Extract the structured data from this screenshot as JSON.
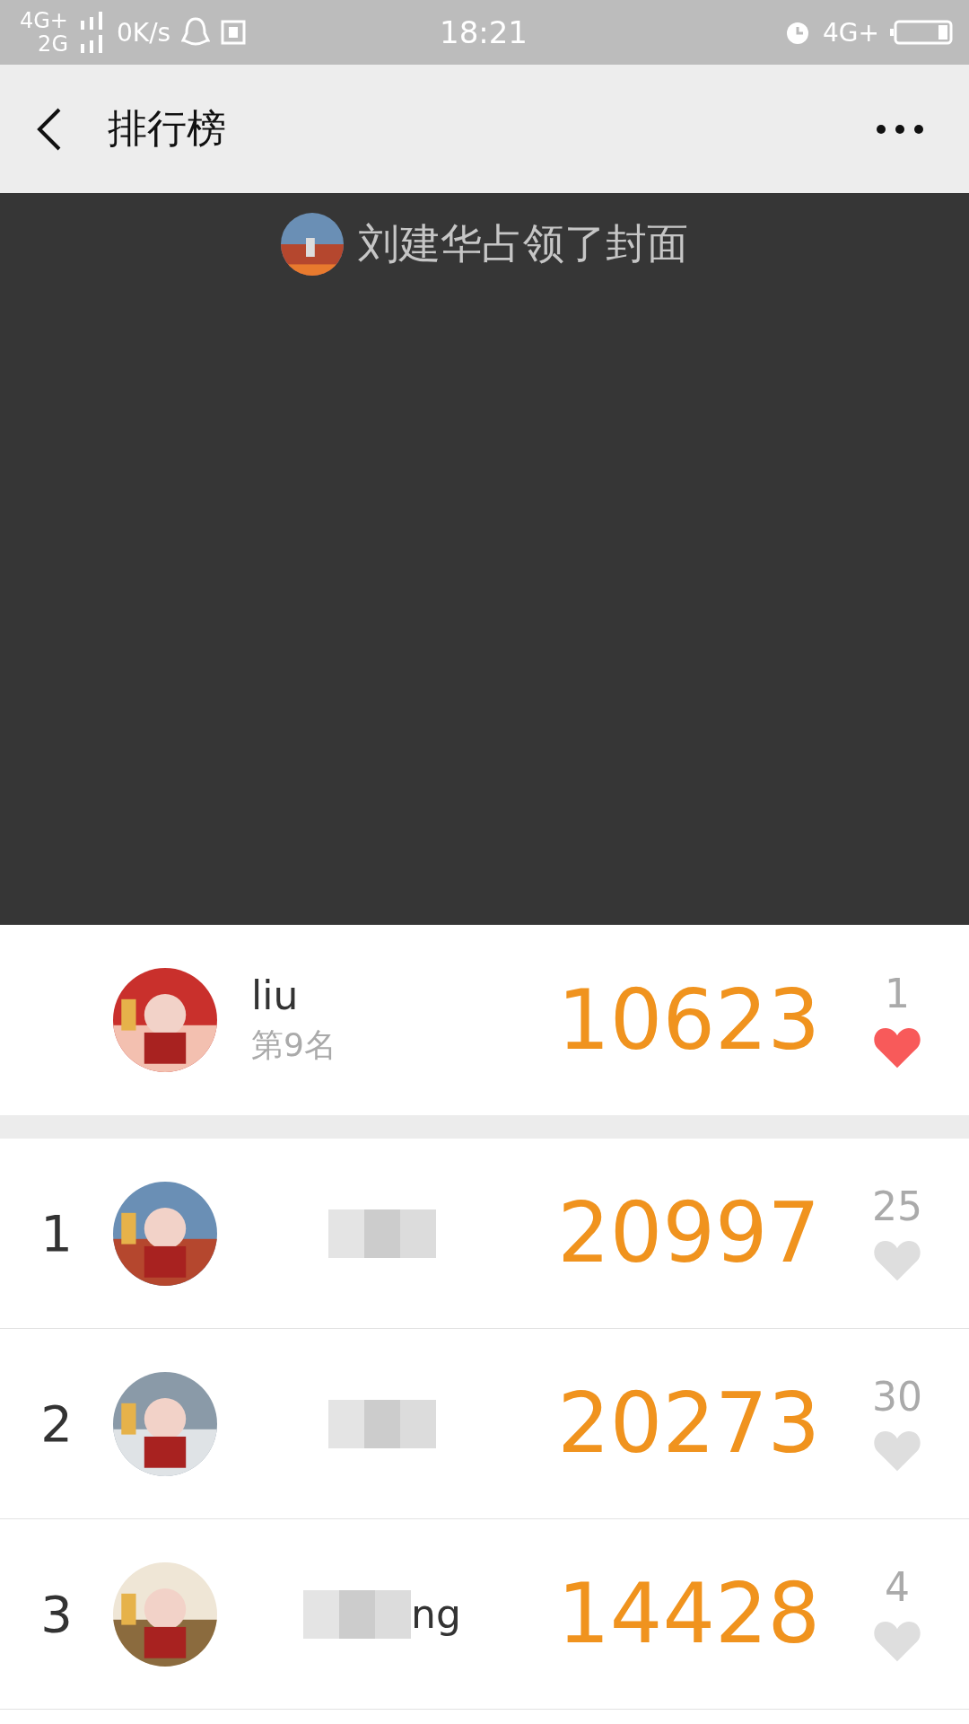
{
  "status_bar": {
    "network_top": "4G+",
    "network_bottom": "2G",
    "speed": "0K/s",
    "time": "18:21",
    "network_right": "4G+"
  },
  "nav": {
    "title": "排行榜"
  },
  "cover": {
    "caption": "刘建华占领了封面"
  },
  "me": {
    "name": "liu",
    "rank_text": "第9名",
    "steps": "10623",
    "likes": "1",
    "liked": true
  },
  "ranking": [
    {
      "rank": "1",
      "steps": "20997",
      "likes": "25",
      "liked": false
    },
    {
      "rank": "2",
      "steps": "20273",
      "likes": "30",
      "liked": false
    },
    {
      "rank": "3",
      "name": "ng",
      "steps": "14428",
      "likes": "4",
      "liked": false
    }
  ]
}
